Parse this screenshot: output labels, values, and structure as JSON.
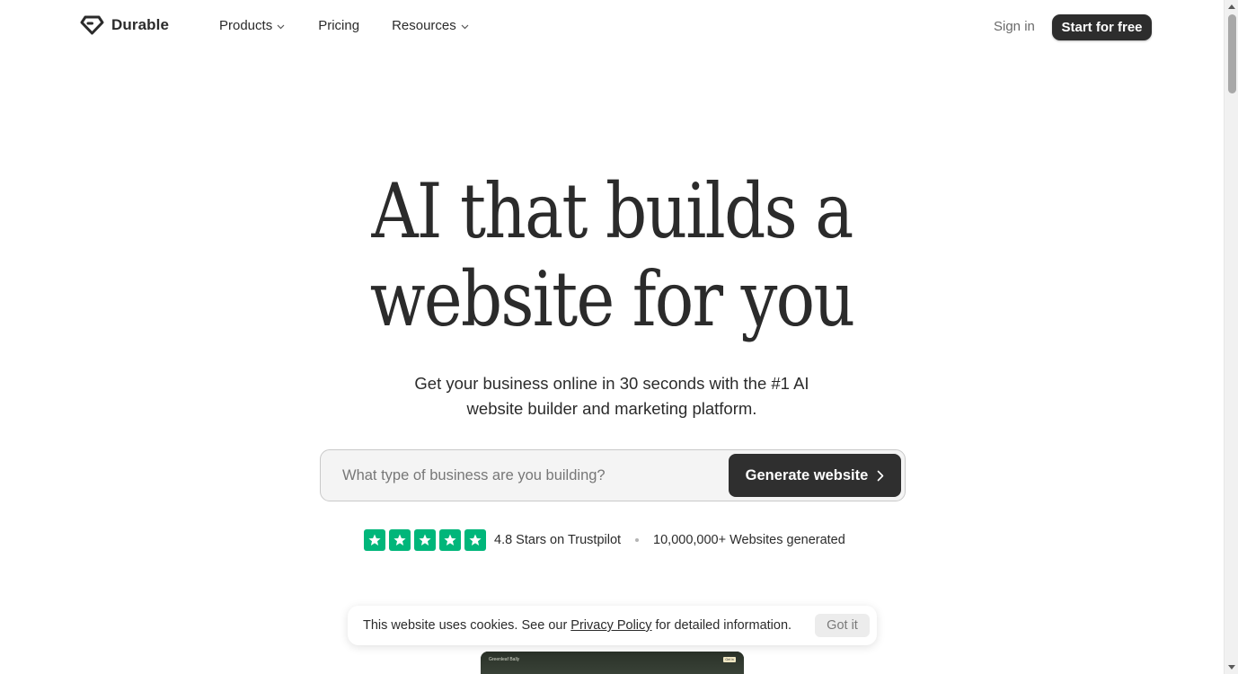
{
  "header": {
    "brand": "Durable",
    "nav": [
      {
        "label": "Products",
        "has_dropdown": true
      },
      {
        "label": "Pricing",
        "has_dropdown": false
      },
      {
        "label": "Resources",
        "has_dropdown": true
      }
    ],
    "sign_in": "Sign in",
    "start_button": "Start for free"
  },
  "hero": {
    "title_line1": "AI that builds a",
    "title_line2": "website for you",
    "subtitle_line1": "Get your business online in 30 seconds with the #1 AI",
    "subtitle_line2": "website builder and marketing platform."
  },
  "search": {
    "placeholder": "What type of business are you building?",
    "value": "",
    "button_label": "Generate website"
  },
  "trust": {
    "rating_text": "4.8 Stars on Trustpilot",
    "stars": 5,
    "websites_text": "10,000,000+ Websites generated",
    "star_color": "#00b67a"
  },
  "cookie_banner": {
    "text_before": "This website uses cookies. See our",
    "link_text": "Privacy Policy",
    "text_after": "for detailed information.",
    "button_label": "Got it"
  },
  "preview": {
    "logo_text": "Greenleaf Bally",
    "button_text": "Get in"
  },
  "colors": {
    "primary_dark": "#2d2d2d",
    "text": "#2b2b2b",
    "muted": "#6a6a6a"
  }
}
